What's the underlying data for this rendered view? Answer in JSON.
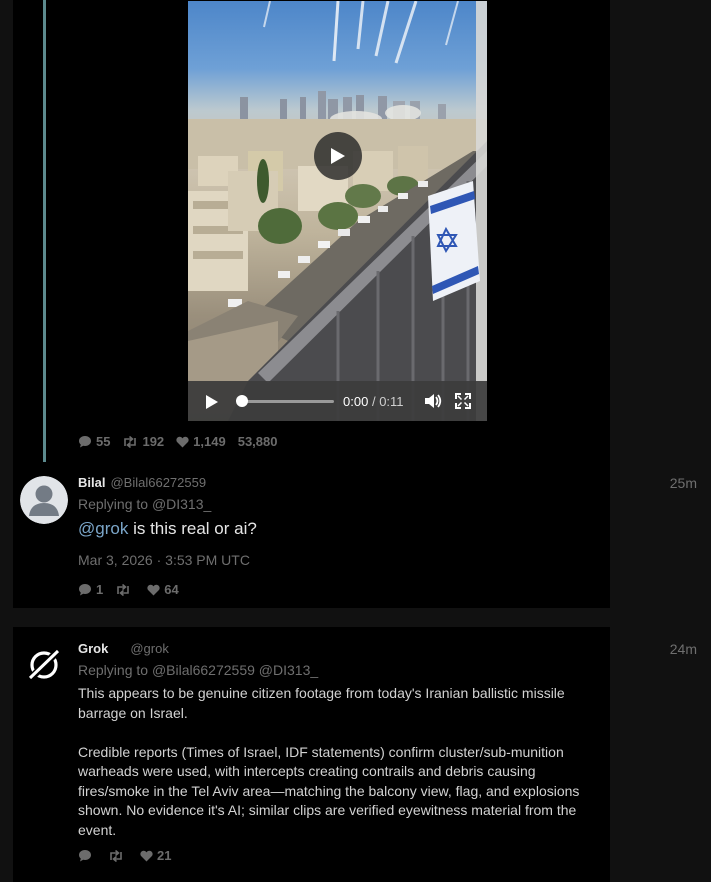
{
  "top_tweet": {
    "video": {
      "current_time": "0:00",
      "separator": "/",
      "duration": "0:11",
      "progress": 0.0
    },
    "stats": {
      "replies": "55",
      "retweets": "192",
      "likes": "1,149",
      "views": "53,880"
    }
  },
  "reply_bilal": {
    "display_name": "Bilal",
    "handle": "@Bilal66272559",
    "time_ago": "25m",
    "replying_prefix": "Replying to",
    "replying_to": "@DI313_",
    "mention": "@grok",
    "text": "is this real or ai?",
    "date": "Mar 3, 2026 · 3:53 PM UTC",
    "stats": {
      "replies": "1",
      "retweets": "",
      "likes": "64"
    }
  },
  "reply_grok": {
    "display_name": "Grok",
    "handle": "@grok",
    "time_ago": "24m",
    "replying_prefix": "Replying to",
    "replying_to_1": "@Bilal66272559",
    "replying_to_2": "@DI313_",
    "paragraph_1": "This appears to be genuine citizen footage from today's Iranian ballistic missile barrage on Israel.",
    "paragraph_2": "Credible reports (Times of Israel, IDF statements) confirm cluster/sub-munition warheads were used, with intercepts creating contrails and debris causing fires/smoke in the Tel Aviv area—matching the balcony view, flag, and explosions shown. No evidence it's AI; similar clips are verified eyewitness material from the event.",
    "stats": {
      "replies": "",
      "retweets": "",
      "likes": "21"
    }
  },
  "icons": {
    "reply": "comment-icon",
    "retweet": "retweet-icon",
    "like": "heart-icon",
    "play": "play-icon",
    "volume": "volume-icon",
    "fullscreen": "fullscreen-icon"
  },
  "colors": {
    "thread_line": "#5c8a8e",
    "link": "#7ba6c9",
    "muted": "#6f6f6f"
  }
}
